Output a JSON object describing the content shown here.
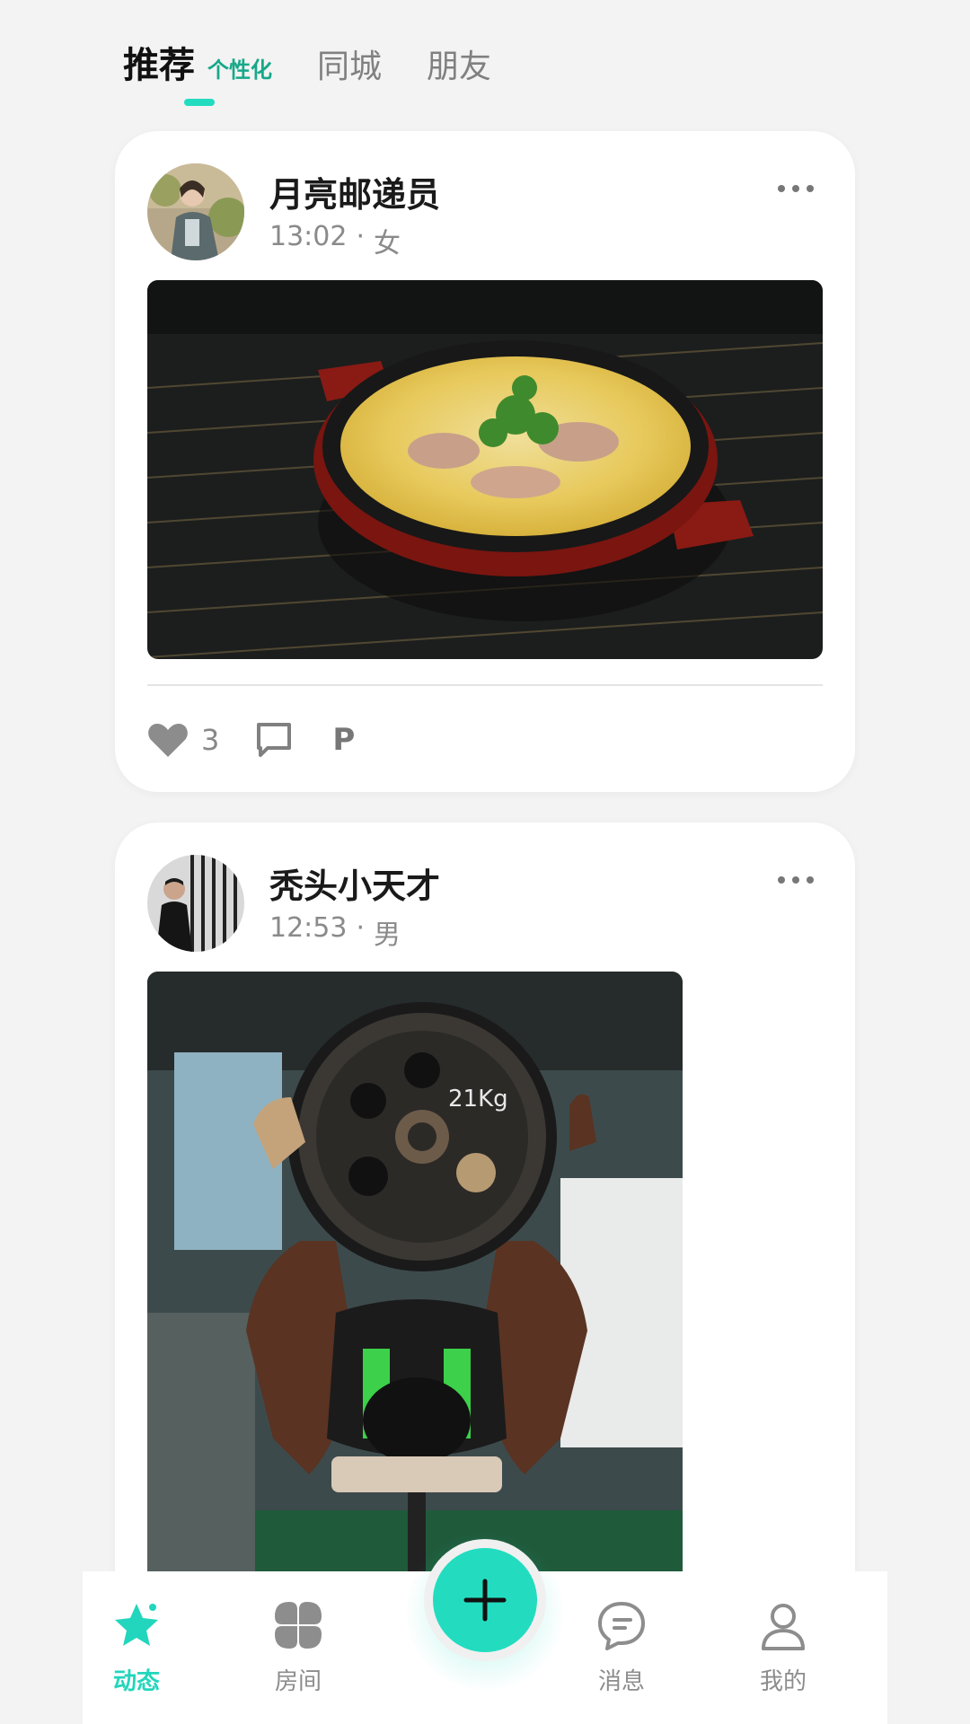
{
  "header": {
    "tabs": [
      {
        "label": "推荐",
        "sub": "个性化",
        "active": true
      },
      {
        "label": "同城"
      },
      {
        "label": "朋友"
      }
    ],
    "accent": "#23dcc0"
  },
  "posts": [
    {
      "username": "月亮邮递员",
      "time": "13:02",
      "separator": "·",
      "gender": "女",
      "image": "food-dish-photo",
      "likes": "3",
      "p_label": "P"
    },
    {
      "username": "秃头小天才",
      "time": "12:53",
      "separator": "·",
      "gender": "男",
      "image": "gym-weightlifting-photo",
      "plate_text": "21Kg"
    }
  ],
  "nav": {
    "items": [
      {
        "label": "动态",
        "icon": "star-icon",
        "active": true
      },
      {
        "label": "房间",
        "icon": "grid-icon"
      },
      {
        "label": "消息",
        "icon": "chat-icon"
      },
      {
        "label": "我的",
        "icon": "profile-icon"
      }
    ],
    "fab_icon": "plus-icon"
  }
}
